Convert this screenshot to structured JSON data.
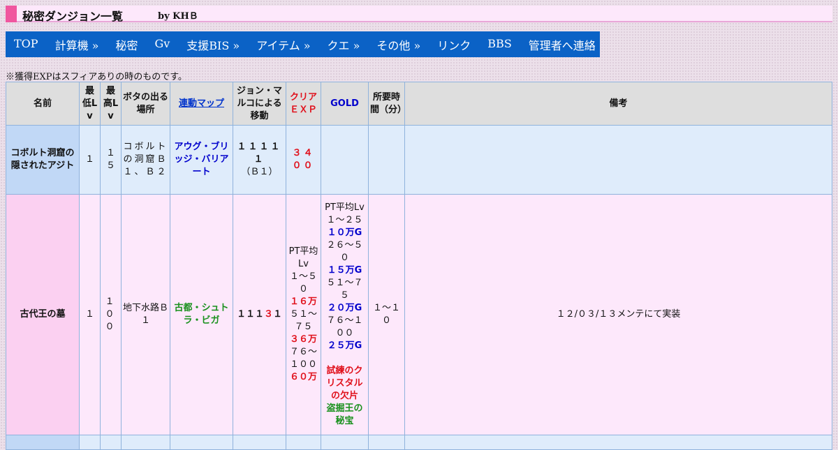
{
  "header": {
    "title": "秘密ダンジョン一覧",
    "by": "by KHＢ"
  },
  "nav": [
    {
      "label": "TOP",
      "raised": true
    },
    {
      "label": "計算機 »",
      "raised": false
    },
    {
      "label": "秘密",
      "raised": false
    },
    {
      "label": "Gv",
      "raised": true
    },
    {
      "label": "支援BIS »",
      "raised": false
    },
    {
      "label": "アイテム »",
      "raised": false
    },
    {
      "label": "クエ »",
      "raised": false
    },
    {
      "label": "その他 »",
      "raised": false
    },
    {
      "label": "リンク",
      "raised": false
    },
    {
      "label": "BBS",
      "raised": true
    },
    {
      "label": "管理者へ連絡",
      "raised": false
    }
  ],
  "note": "※獲得EXPはスフィアありの時のものです。",
  "table": {
    "headers": {
      "name": "名前",
      "min_lv": "最低Lv",
      "max_lv": "最高Lv",
      "boss": "ボタの出る場所",
      "map": "連動マップ",
      "jon": "ジョン・マルコによる移動",
      "clear_exp": "クリアＥＸＰ",
      "gold": "GOLD",
      "time": "所要時間（分）",
      "remark": "備考"
    },
    "rows": [
      {
        "name": "コボルト洞窟の隠されたアジト",
        "min_lv": "１",
        "max_lv": "１５",
        "boss": "コボルトの洞窟Ｂ１、Ｂ２",
        "map": "アウグ・ブリッジ・バリアート",
        "jon_main": "１１１１１",
        "jon_sub": "（Ｂ１）",
        "exp": "３４００",
        "gold": "",
        "time": "",
        "remark": ""
      },
      {
        "name": "古代王の墓",
        "min_lv": "１",
        "max_lv": "１００",
        "boss": "地下水路Ｂ１",
        "map": "古都・シュトラ・ビガ",
        "jon_a": "１１１",
        "jon_b": "３",
        "jon_c": "１",
        "exp_pt_label": "PT平均 Lv",
        "exp_tiers": [
          {
            "range": "１～５０",
            "value": "１６万"
          },
          {
            "range": "５１～７５",
            "value": "３６万"
          },
          {
            "range": "７６～１００",
            "value": "６０万"
          }
        ],
        "gold_pt_label": "PT平均Lv",
        "gold_tiers": [
          {
            "range": "１～２５",
            "value": "１０万G"
          },
          {
            "range": "２６～５０",
            "value": "１５万G"
          },
          {
            "range": "５１～７５",
            "value": "２０万G"
          },
          {
            "range": "７６～１００",
            "value": "２５万G"
          }
        ],
        "gold_item_red": "試練のクリスタルの欠片",
        "gold_item_green": "盗掘王の秘宝",
        "time": "１～１０",
        "remark": "１２/０３/１３メンテにて実装"
      }
    ]
  },
  "colors": {
    "nav": "#0b62c6",
    "title_mark": "#f0569f",
    "row_blue": "#dfecfb",
    "row_pink": "#fde8fb"
  }
}
